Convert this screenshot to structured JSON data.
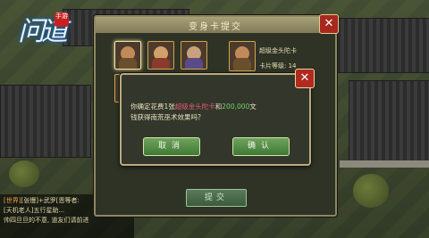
{
  "logo": {
    "title": "问道",
    "seal": "手游"
  },
  "chat": {
    "line1_tag": "[世界]",
    "line1": "[张慢]+武罗[恩等者:",
    "line2": "[天机老人]五行星助...",
    "line3": "帅四旦旦的不意, 道友们请前进"
  },
  "panel": {
    "title": "变身卡提交",
    "card_name": "超级金头陀卡",
    "card_level": "卡片等级: 14",
    "submit_label": "提交"
  },
  "dialog": {
    "msg_prefix": "你确定花费1张",
    "msg_card": "超级金头陀卡",
    "msg_and": "和",
    "msg_amount": "200,000",
    "msg_unit": "文",
    "msg_line2": "钱获得南荒巫术效果吗？",
    "cancel_label": "取消",
    "ok_label": "确认"
  },
  "colors": {
    "highlight_card": "#e35a7a",
    "highlight_amount": "#6fd26c",
    "button": "#4f8b43",
    "close": "#b12a1f"
  },
  "icons": {
    "panel_close": "close-icon",
    "dialog_close": "close-icon"
  }
}
